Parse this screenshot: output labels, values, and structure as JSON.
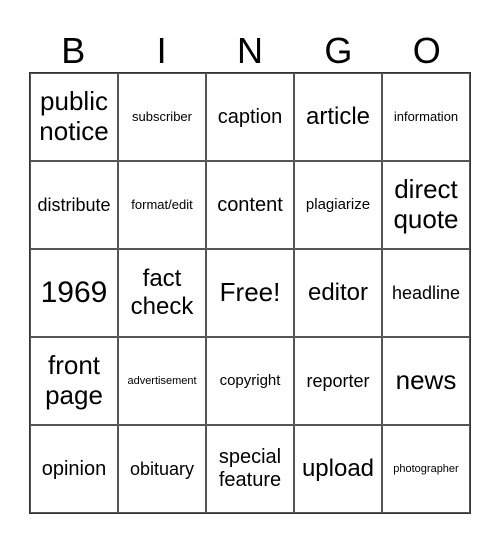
{
  "title_letters": [
    "B",
    "I",
    "N",
    "G",
    "O"
  ],
  "rows": [
    [
      "public notice",
      "subscriber",
      "caption",
      "article",
      "information"
    ],
    [
      "distribute",
      "format/edit",
      "content",
      "plagiarize",
      "direct quote"
    ],
    [
      "1969",
      "fact check",
      "Free!",
      "editor",
      "headline"
    ],
    [
      "front page",
      "advertisement",
      "copyright",
      "reporter",
      "news"
    ],
    [
      "opinion",
      "obituary",
      "special feature",
      "upload",
      "photographer"
    ]
  ],
  "free_space_label": "Free!"
}
